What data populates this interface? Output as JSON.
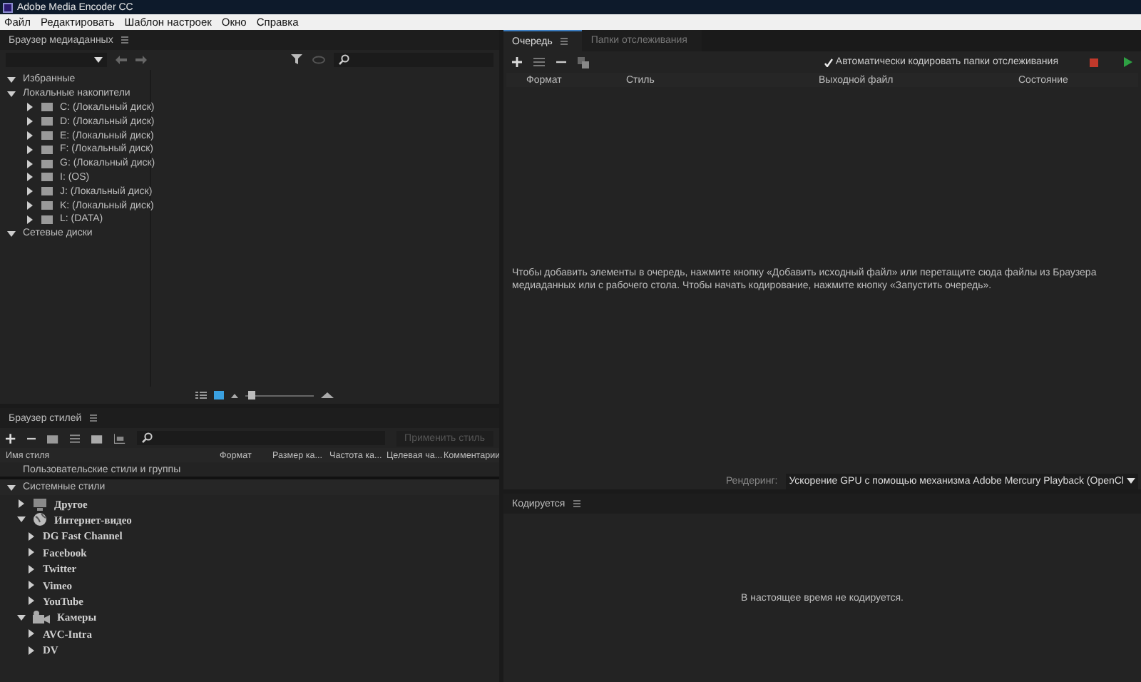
{
  "window": {
    "title": "Adobe Media Encoder CC"
  },
  "menu": [
    "Файл",
    "Редактировать",
    "Шаблон настроек",
    "Окно",
    "Справка"
  ],
  "media_browser": {
    "title": "Браузер медиаданных",
    "zoom": {
      "level": 0.1
    },
    "tree": [
      {
        "label": "Избранные",
        "expanded": true
      },
      {
        "label": "Локальные накопители",
        "expanded": true,
        "children": [
          {
            "label": "C: (Локальный диск)",
            "expanded": false
          },
          {
            "label": "D: (Локальный диск)",
            "expanded": false
          },
          {
            "label": "E: (Локальный диск)",
            "expanded": false
          },
          {
            "label": "F: (Локальный диск)",
            "expanded": false
          },
          {
            "label": "G: (Локальный диск)",
            "expanded": false
          },
          {
            "label": "I: (OS)",
            "expanded": false
          },
          {
            "label": "J: (Локальный диск)",
            "expanded": false
          },
          {
            "label": "K: (Локальный диск)",
            "expanded": false
          },
          {
            "label": "L: (DATA)",
            "expanded": false
          }
        ]
      },
      {
        "label": "Сетевые диски",
        "expanded": true
      }
    ]
  },
  "preset_browser": {
    "title": "Браузер стилей",
    "apply_button": "Применить стиль",
    "columns": [
      "Имя стиля",
      "Формат",
      "Размер ка...",
      "Частота ка...",
      "Целевая ча...",
      "Комментарии"
    ],
    "user_group": "Пользовательские стили и группы",
    "system_group": {
      "label": "Системные стили",
      "expanded": true,
      "children": [
        {
          "label": "Другое",
          "kind": "monitor",
          "expanded": false
        },
        {
          "label": "Интернет-видео",
          "kind": "globe",
          "expanded": true,
          "children": [
            {
              "label": "DG Fast Channel",
              "expanded": false
            },
            {
              "label": "Facebook",
              "expanded": false
            },
            {
              "label": "Twitter",
              "expanded": false
            },
            {
              "label": "Vimeo",
              "expanded": false
            },
            {
              "label": "YouTube",
              "expanded": false
            }
          ]
        },
        {
          "label": "Камеры",
          "kind": "camera",
          "expanded": true,
          "children": [
            {
              "label": "AVC-Intra",
              "expanded": false
            },
            {
              "label": "DV",
              "expanded": false
            }
          ]
        }
      ]
    }
  },
  "queue": {
    "tabs": [
      {
        "label": "Очередь",
        "selected": true
      },
      {
        "label": "Папки отслеживания",
        "selected": false
      }
    ],
    "auto_encode": {
      "label": "Автоматически кодировать папки отслеживания",
      "checked": true
    },
    "columns": [
      "Формат",
      "Стиль",
      "Выходной файл",
      "Состояние"
    ],
    "hint": "Чтобы добавить элементы в очередь, нажмите кнопку «Добавить исходный файл» или перетащите сюда файлы из Браузера медиаданных или с рабочего стола. Чтобы начать кодирование, нажмите кнопку «Запустить очередь».",
    "renderer": {
      "label": "Рендеринг:",
      "value": "Ускорение GPU с помощью механизма Adobe Mercury Playback (OpenCl"
    }
  },
  "encoding": {
    "title": "Кодируется",
    "message": "В настоящее время не кодируется."
  }
}
